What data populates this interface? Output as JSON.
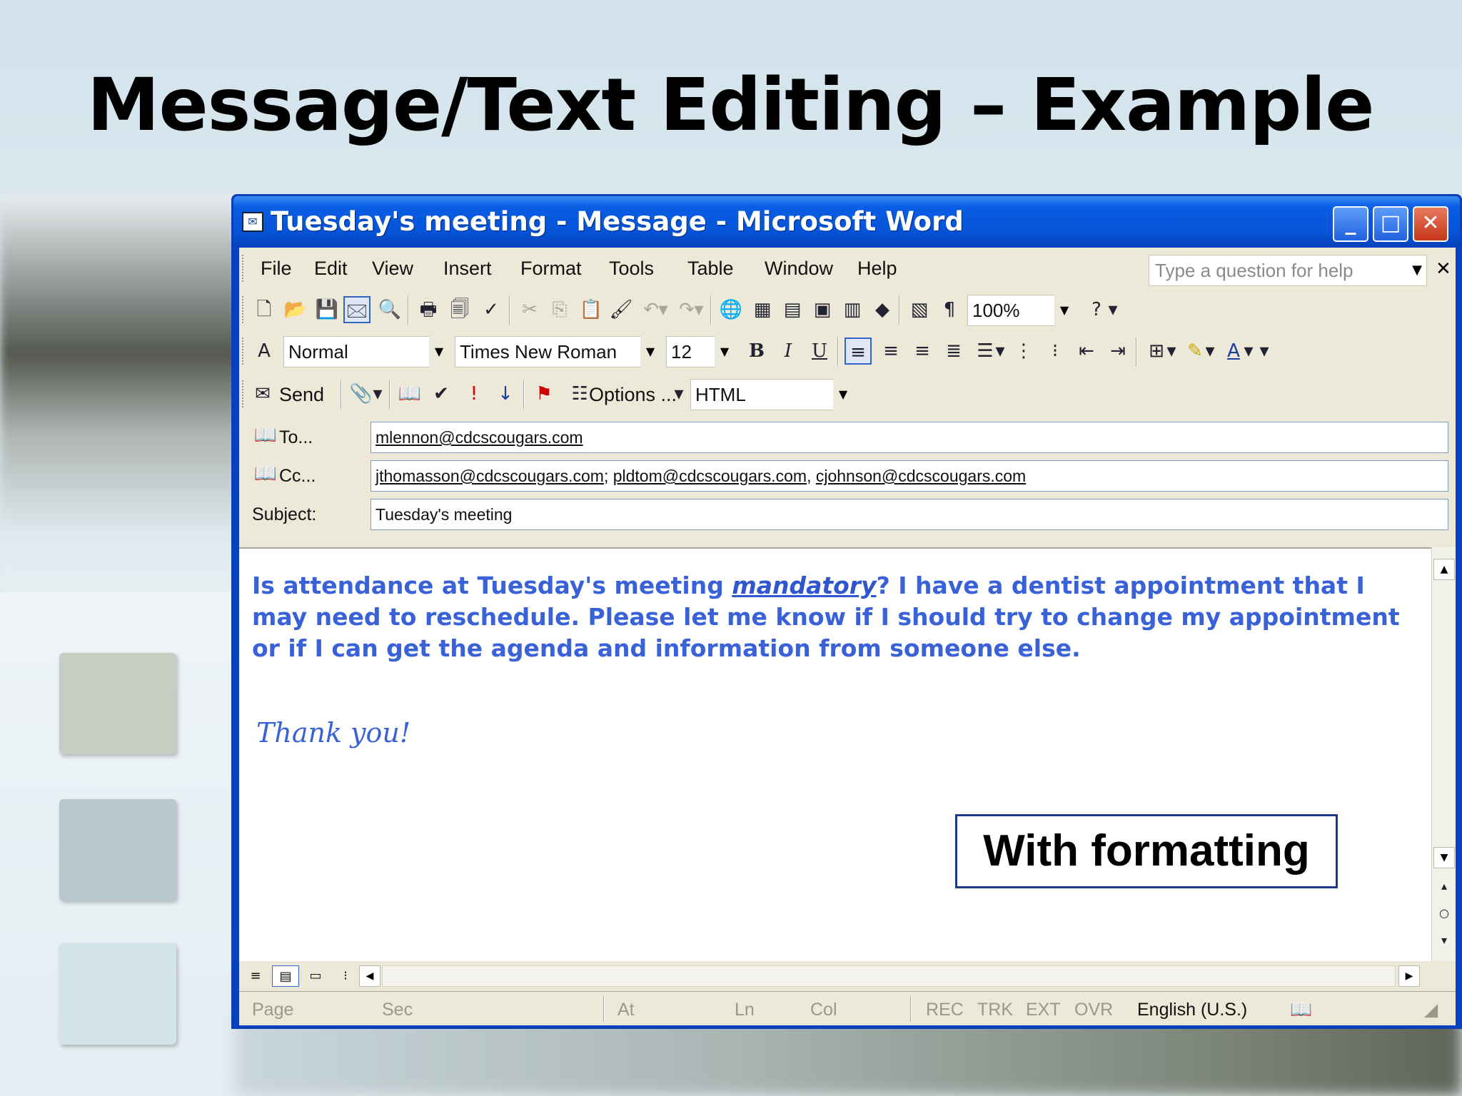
{
  "slide": {
    "title": "Message/Text Editing – Example"
  },
  "window": {
    "title": "Tuesday's meeting - Message - Microsoft Word",
    "icon": "word-document-icon"
  },
  "menubar": {
    "items": [
      "File",
      "Edit",
      "View",
      "Insert",
      "Format",
      "Tools",
      "Table",
      "Window",
      "Help"
    ],
    "help_placeholder": "Type a question for help"
  },
  "standard_toolbar": {
    "zoom": "100%"
  },
  "formatting_toolbar": {
    "style": "Normal",
    "font": "Times New Roman",
    "size": "12"
  },
  "email_toolbar": {
    "send_label": "Send",
    "options_label": "Options ...",
    "format": "HTML"
  },
  "header": {
    "to_label": "To...",
    "to_value": "mlennon@cdcscougars.com",
    "cc_label": "Cc...",
    "cc_value_1": "jthomasson@cdcscougars.com",
    "cc_value_2": "pldtom@cdcscougars.com",
    "cc_value_3": "cjohnson@cdcscougars.com",
    "cc_sep_1": "; ",
    "cc_sep_2": ", ",
    "subject_label": "Subject:",
    "subject_value": "Tuesday's meeting"
  },
  "body": {
    "text_before": "Is attendance at Tuesday's meeting ",
    "mandatory": "mandatory",
    "text_after": "?  I have a dentist appointment that I may need to reschedule.  Please let me know if I should try to change my appointment or if I can get the agenda and information from someone else.",
    "signoff": "Thank you!"
  },
  "callout": {
    "text": "With formatting"
  },
  "statusbar": {
    "page": "Page",
    "sec": "Sec",
    "at": "At",
    "ln": "Ln",
    "col": "Col",
    "rec": "REC",
    "trk": "TRK",
    "ext": "EXT",
    "ovr": "OVR",
    "language": "English (U.S.)"
  },
  "colors": {
    "body_text": "#3a62d8",
    "titlebar": "#0553d8",
    "chrome": "#ece9d8"
  }
}
